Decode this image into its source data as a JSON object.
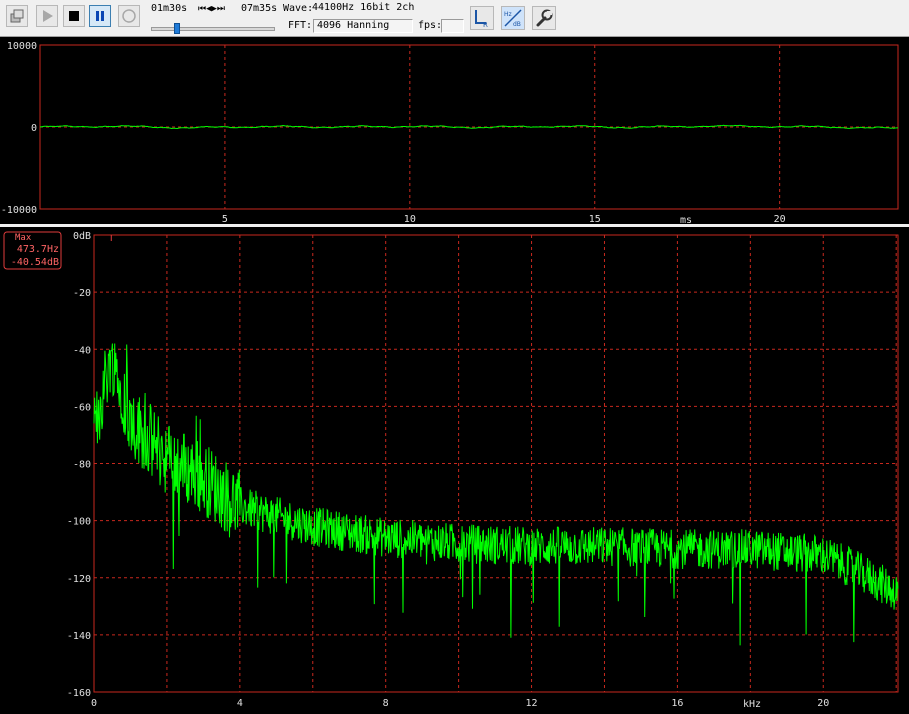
{
  "toolbar": {
    "time_current": "01m30s",
    "transport_glyphs": "⏮◀▶⏭",
    "time_total": "07m35s",
    "wave_label": "Wave:",
    "wave_value": "44100Hz 16bit 2ch",
    "fft_label": "FFT:",
    "fft_value": "4096 Hanning",
    "fps_label": "fps:",
    "fps_value": "",
    "playback_position": 0.2,
    "lr_icon_text": "L R",
    "hz_db_icon_text": "Hz dB",
    "buttons": [
      "open-icon",
      "play-icon",
      "stop-icon",
      "pause-icon",
      "record-icon",
      "channel-lr-icon",
      "scale-hz-db-icon",
      "settings-wrench-icon"
    ]
  },
  "waveform": {
    "y_ticks": [
      "10000",
      "0",
      "-10000"
    ],
    "x_ticks": [
      "5",
      "10",
      "15",
      "20"
    ],
    "x_unit": "ms",
    "y_range": [
      -10000,
      10000
    ],
    "x_range_ms": [
      0,
      23.2
    ],
    "trace_color": "#00ff00",
    "grid_color": "#c8281e"
  },
  "spectrum": {
    "max_label": "Max",
    "max_freq": "473.7Hz",
    "max_level": "-40.54dB",
    "y_ticks": [
      "0dB",
      "-20",
      "-40",
      "-60",
      "-80",
      "-100",
      "-120",
      "-140",
      "-160"
    ],
    "x_ticks": [
      "0",
      "4",
      "8",
      "12",
      "16",
      "20"
    ],
    "x_unit": "kHz",
    "y_range_db": [
      -160,
      0
    ],
    "x_range_khz": [
      0,
      22.05
    ],
    "trace_color": "#00ff00",
    "grid_color": "#c8281e"
  },
  "chart_data": [
    {
      "type": "line",
      "title": "",
      "xlabel": "ms",
      "ylabel": "",
      "xlim": [
        0,
        23.2
      ],
      "ylim": [
        -10000,
        10000
      ],
      "series": [
        {
          "x": [
            0,
            2,
            4,
            6,
            8,
            10,
            12,
            14,
            16,
            18,
            20,
            22,
            23.2
          ],
          "y": [
            0,
            100,
            -100,
            50,
            0,
            80,
            -50,
            100,
            -50,
            120,
            60,
            -50,
            -200
          ]
        }
      ]
    },
    {
      "type": "line",
      "title": "",
      "xlabel": "kHz",
      "ylabel": "dB",
      "xlim": [
        0,
        22.05
      ],
      "ylim": [
        -160,
        0
      ],
      "series": [
        {
          "x": [
            0,
            0.47,
            1,
            2,
            3,
            4,
            6,
            8,
            10,
            12,
            14,
            16,
            18,
            20,
            21,
            22
          ],
          "y": [
            -70,
            -41,
            -65,
            -78,
            -85,
            -95,
            -102,
            -106,
            -108,
            -109,
            -109,
            -110,
            -110,
            -112,
            -118,
            -125
          ]
        }
      ]
    }
  ]
}
